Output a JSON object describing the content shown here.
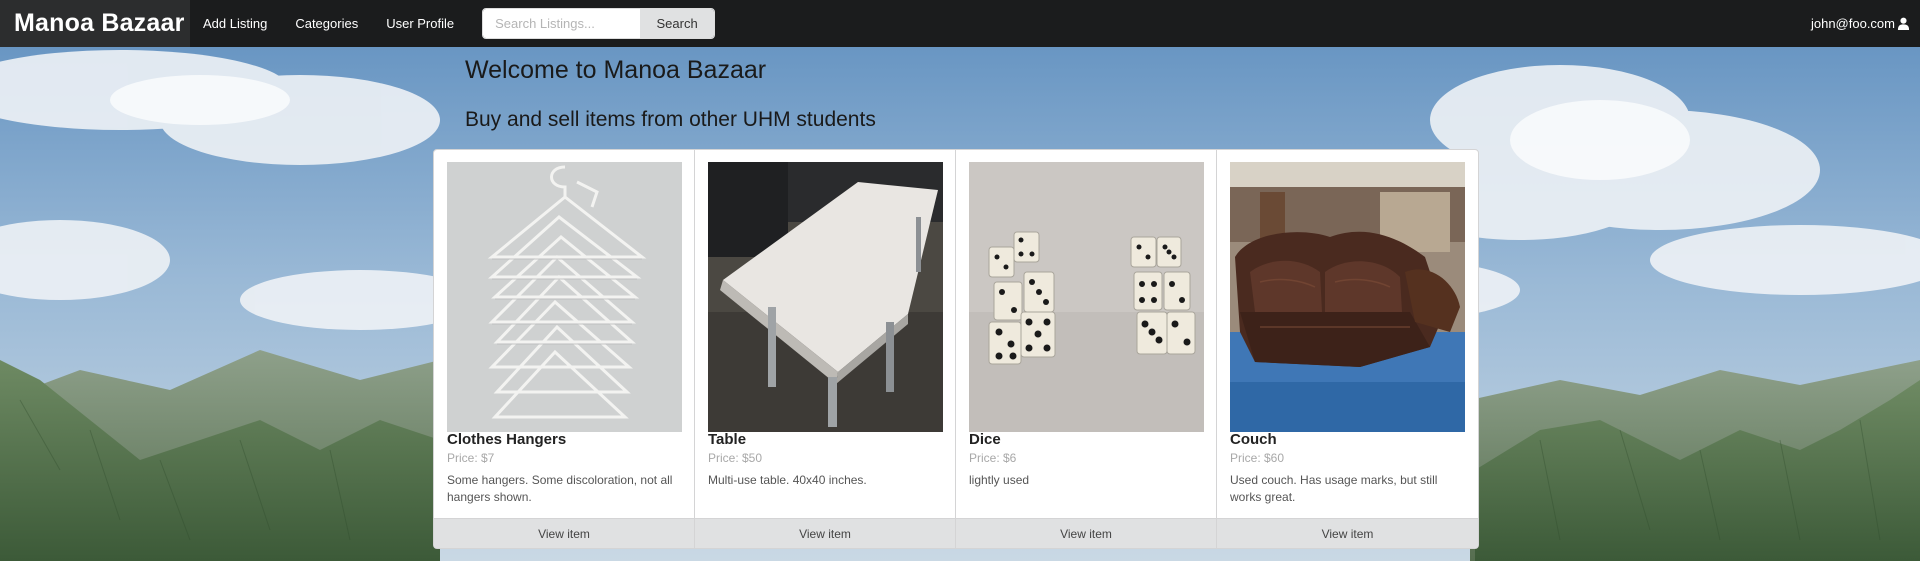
{
  "navbar": {
    "brand": "Manoa Bazaar",
    "links": [
      "Add Listing",
      "Categories",
      "User Profile"
    ],
    "search": {
      "placeholder": "Search Listings...",
      "value": "",
      "button_label": "Search"
    },
    "user": {
      "email": "john@foo.com",
      "icon": "user-icon"
    }
  },
  "hero": {
    "title": "Welcome to Manoa Bazaar",
    "subtitle": "Buy and sell items from other UHM students"
  },
  "listings": [
    {
      "name": "Clothes Hangers",
      "price": "Price: $7",
      "description": "Some hangers. Some discoloration, not all hangers shown.",
      "action": "View item"
    },
    {
      "name": "Table",
      "price": "Price: $50",
      "description": "Multi-use table. 40x40 inches.",
      "action": "View item"
    },
    {
      "name": "Dice",
      "price": "Price: $6",
      "description": "lightly used",
      "action": "View item"
    },
    {
      "name": "Couch",
      "price": "Price: $60",
      "description": "Used couch. Has usage marks, but still works great.",
      "action": "View item"
    }
  ],
  "colors": {
    "navbar": "#1b1c1d",
    "brand_bg": "#2c2d2e",
    "button_bg": "#e0e1e2"
  }
}
